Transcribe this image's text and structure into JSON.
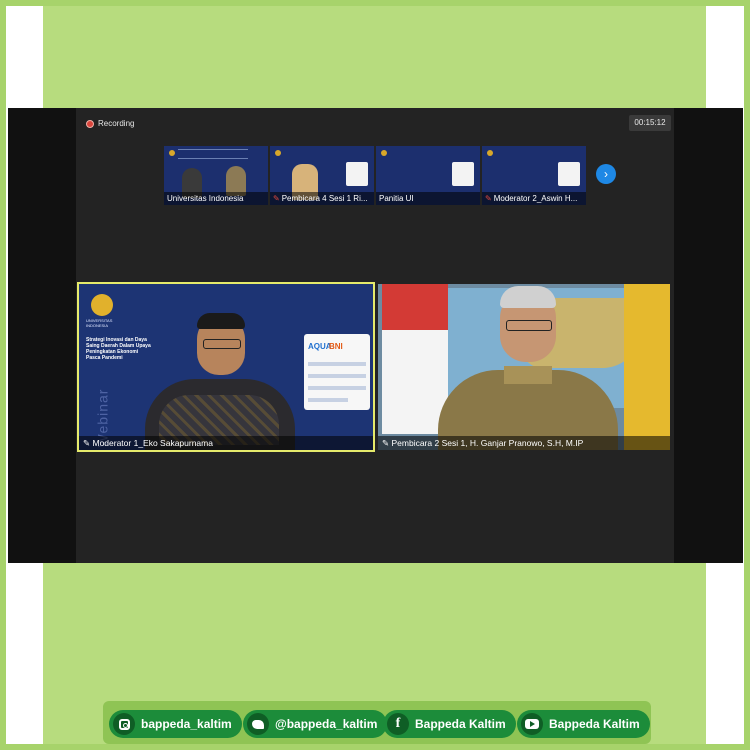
{
  "meeting": {
    "recording_label": "Recording",
    "timer": "00:15:12",
    "next_icon": "chevron-right-icon"
  },
  "thumbnails": [
    {
      "label": "Universitas Indonesia",
      "muted": false
    },
    {
      "label": "Pembicara 4 Sesi 1 Ri...",
      "muted": true
    },
    {
      "label": "Panitia UI",
      "muted": false
    },
    {
      "label": "Moderator 2_Aswin H...",
      "muted": true
    }
  ],
  "videos": [
    {
      "label": "Moderator 1_Eko Sakapurnama",
      "slide_org": "UNIVERSITAS INDONESIA",
      "slide_title": "Strategi Inovasi dan Daya Saing Daerah Dalam Upaya Peningkatan Ekonomi Pasca Pandemi",
      "sponsor_1": "AQUA",
      "sponsor_2": "BNI",
      "watermark": "Webinar"
    },
    {
      "label": "Pembicara 2 Sesi 1, H. Ganjar Pranowo, S.H, M.IP"
    }
  ],
  "social": [
    {
      "icon": "instagram-icon",
      "label": "bappeda_kaltim"
    },
    {
      "icon": "twitter-icon",
      "label": "@bappeda_kaltim"
    },
    {
      "icon": "facebook-icon",
      "label": "Bappeda Kaltim"
    },
    {
      "icon": "youtube-icon",
      "label": "Bappeda Kaltim"
    }
  ],
  "colors": {
    "frame_green": "#b7dc7e",
    "pill_green": "#1c8c3a",
    "highlight_border": "#e5ea6b",
    "next_button": "#1e88e5"
  }
}
